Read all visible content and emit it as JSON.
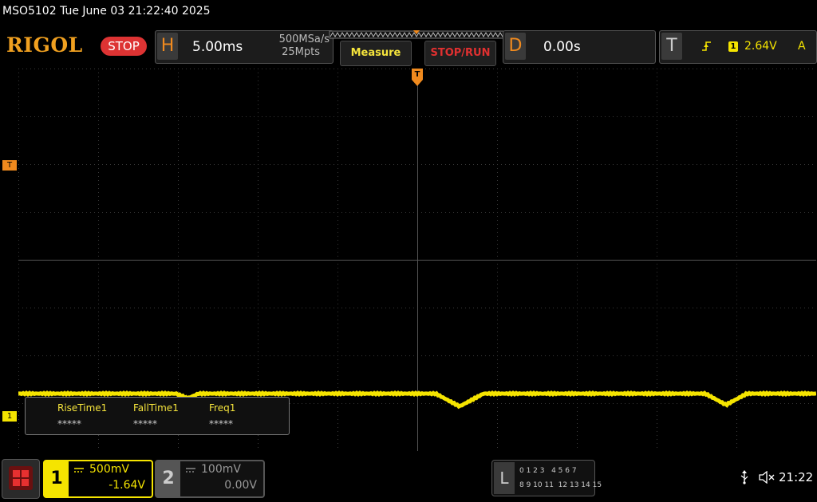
{
  "window": {
    "title": "MSO5102  Tue June 03 21:22:40 2025"
  },
  "header": {
    "logo": "RIGOL",
    "run_state": "STOP",
    "horizontal": {
      "letter": "H",
      "timebase": "5.00ms",
      "sample_rate": "500MSa/s",
      "memory_depth": "25Mpts"
    },
    "measure_label": "Measure",
    "stoprun_label": "STOP/RUN",
    "delay": {
      "letter": "D",
      "value": "0.00s"
    },
    "trigger": {
      "letter": "T",
      "source": "1",
      "level": "2.64V",
      "mode": "A"
    }
  },
  "markers": {
    "trigger_top": "T",
    "trigger_level": "T",
    "ch1_ground": "1"
  },
  "measurements": [
    {
      "label": "RiseTime1",
      "value": "*****"
    },
    {
      "label": "FallTime1",
      "value": "*****"
    },
    {
      "label": "Freq1",
      "value": "*****"
    }
  ],
  "channels": [
    {
      "number": "1",
      "scale": "500mV",
      "offset": "-1.64V",
      "color": "#f5e400",
      "active": true
    },
    {
      "number": "2",
      "scale": "100mV",
      "offset": "0.00V",
      "color": "#888888",
      "active": false
    }
  ],
  "logic": {
    "letter": "L",
    "row1": "0 1 2 3   4 5 6 7",
    "row2": "8 9 10 11  12 13 14 15"
  },
  "status": {
    "time": "21:22"
  },
  "colors": {
    "accent": "#f08a1e",
    "trace": "#f5e400",
    "stop": "#d33333"
  },
  "icons": [
    "menu-icon",
    "usb-icon",
    "speaker-muted-icon",
    "dc-coupling-icon",
    "trigger-edge-icon"
  ]
}
